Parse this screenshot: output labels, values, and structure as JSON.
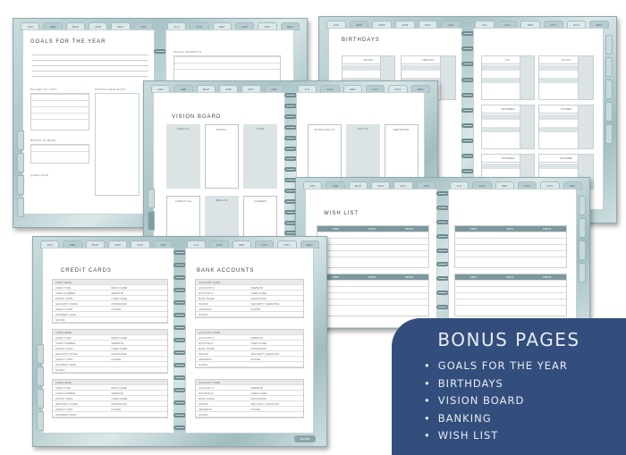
{
  "months": [
    "JAN",
    "FEB",
    "MAR",
    "APR",
    "MAY",
    "JUN",
    "JUL",
    "AUG",
    "SEP",
    "OCT",
    "NOV",
    "DEC"
  ],
  "goals_page": {
    "title": "GOALS FOR THE YEAR",
    "social_label": "SOCIAL MOMENTS",
    "places_label": "PLACES TO VISIT",
    "photo_label": "PHOTO HIGHLIGHTS",
    "books_label": "BOOKS TO READ",
    "questions_label": "QUESTIONS"
  },
  "birthdays_page": {
    "title": "BIRTHDAYS",
    "months": [
      "JANUARY",
      "FEBRUARY",
      "JULY",
      "AUGUST",
      "SEPTEMBER",
      "OCTOBER",
      "NOVEMBER",
      "DECEMBER"
    ],
    "day_label": "DAY",
    "gift_label": "GIFT IDEAS"
  },
  "vision_page": {
    "title": "VISION BOARD",
    "boxes": [
      "HEALTH",
      "FAMILY",
      "LOVE",
      "SPIRITUALITY",
      "SKILLS",
      "PERSONAL",
      "LIFESTYLE",
      "WEALTH",
      "CAREER"
    ]
  },
  "wish_page": {
    "title": "WISH LIST",
    "columns": [
      "ITEM",
      "DATE",
      "PRICE"
    ]
  },
  "banking_page": {
    "credit_title": "CREDIT CARDS",
    "bank_title": "BANK ACCOUNTS",
    "card_fields": [
      "CARD NAME",
      "CARD TYPE",
      "CARD NUMBER",
      "EXPIRY DATE",
      "SECURITY CODE",
      "CREDIT LIMIT",
      "INTEREST RATE",
      "NOTES"
    ],
    "card_right_fields": [
      "BANK NAME",
      "WEBSITE",
      "USER NAME",
      "PASSWORD",
      "PHONE"
    ],
    "card_type_options": [
      "CREDIT",
      "DEBIT"
    ],
    "account_fields": [
      "ACCOUNT NAME",
      "ACCOUNT #",
      "ROUTING #",
      "BANK NAME",
      "PHONE",
      "ADDRESS",
      "NOTES"
    ],
    "account_right_fields": [
      "WEBSITE",
      "USER NAME",
      "PASSWORD",
      "SECURITY QUESTION",
      "PHONE"
    ],
    "notes_button": "NOTES"
  },
  "bonus": {
    "heading": "BONUS PAGES",
    "items": [
      "GOALS FOR THE YEAR",
      "BIRTHDAYS",
      "VISION BOARD",
      "BANKING",
      "WISH LIST"
    ],
    "bg_color": "#334e7d"
  }
}
